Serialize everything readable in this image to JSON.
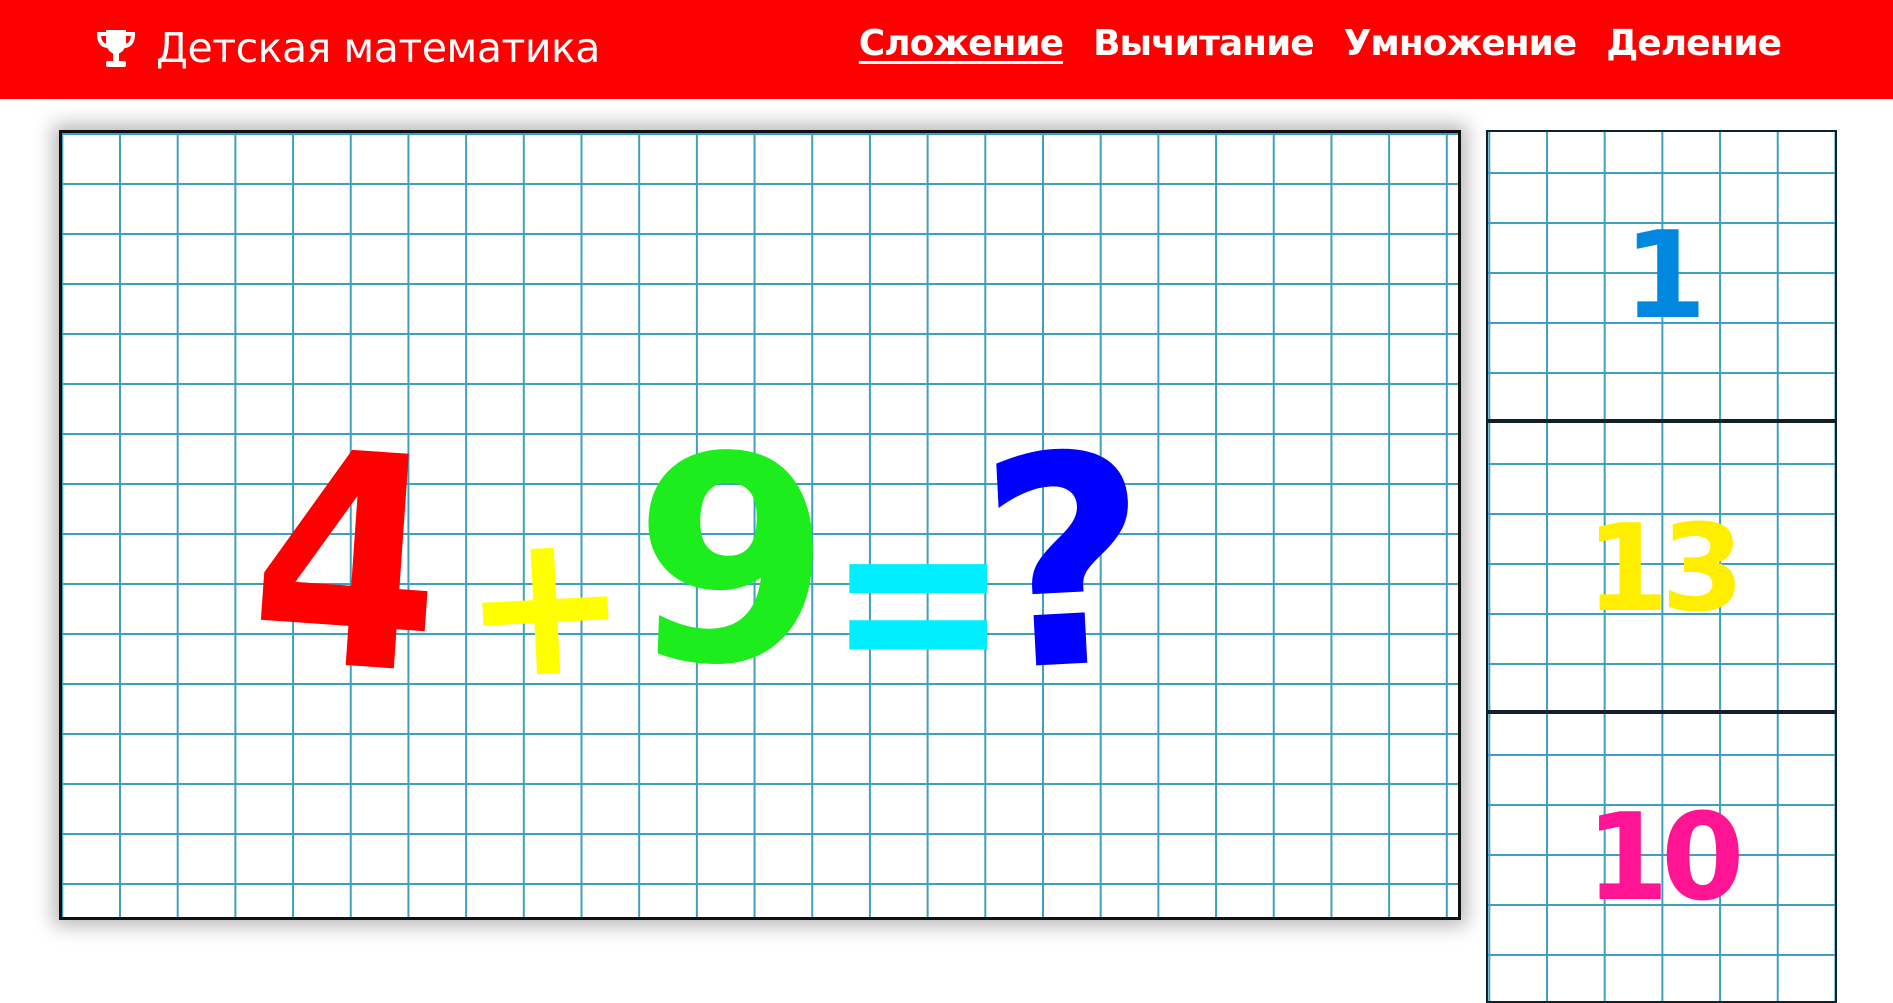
{
  "header": {
    "title": "Детская математика",
    "brand_color": "#ff0000",
    "icon": "trophy-icon",
    "nav": [
      {
        "label": "Сложение",
        "active": true
      },
      {
        "label": "Вычитание",
        "active": false
      },
      {
        "label": "Умножение",
        "active": false
      },
      {
        "label": "Деление",
        "active": false
      }
    ]
  },
  "problem": {
    "left": "4",
    "operator": "+",
    "right": "9",
    "equals": "=",
    "unknown": "?",
    "colors": {
      "left": "#ff0000",
      "operator": "#ffff00",
      "right": "#1ded1d",
      "equals": "#00eeff",
      "unknown": "#0000ff"
    }
  },
  "answers": [
    {
      "value": "1",
      "color": "#0088e0"
    },
    {
      "value": "13",
      "color": "#ffee00"
    },
    {
      "value": "10",
      "color": "#ff1493"
    }
  ],
  "grid_color": "#3f9fbf"
}
